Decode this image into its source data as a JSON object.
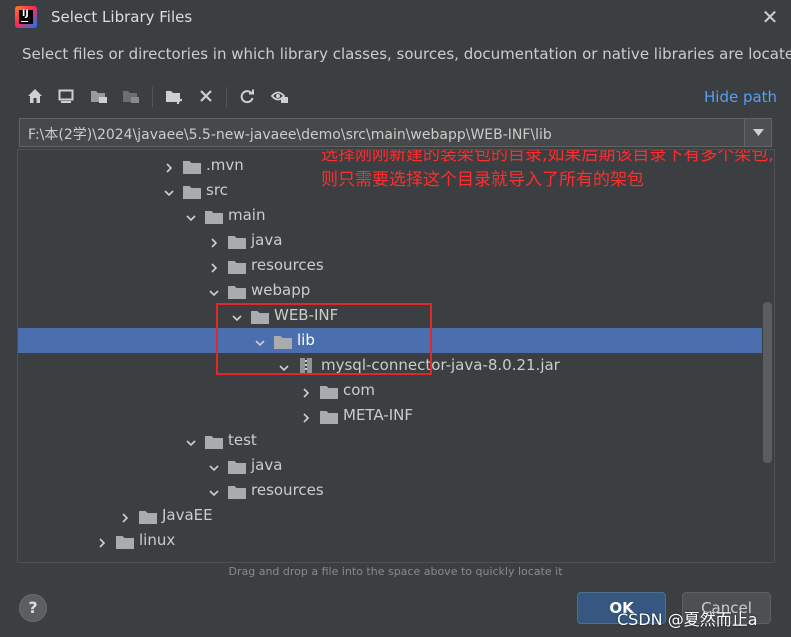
{
  "window": {
    "title": "Select Library Files",
    "close_glyph": "✕",
    "app_logo_text": "IJ",
    "description": "Select files or directories in which library classes, sources, documentation or native libraries are located"
  },
  "toolbar": {
    "buttons": [
      "home-icon",
      "desktop-icon",
      "project-folder-icon",
      "module-folder-icon",
      "new-folder-icon",
      "delete-icon",
      "refresh-icon",
      "show-hidden-icon"
    ],
    "hide_path_label": "Hide path"
  },
  "path": {
    "value": "F:\\本(2学)\\2024\\javaee\\5.5-new-javaee\\demo\\src\\main\\webapp\\WEB-INF\\lib"
  },
  "tree": {
    "rows": [
      {
        "label": ".mvn",
        "expanded": false,
        "type": "folder"
      },
      {
        "label": "src",
        "expanded": true,
        "type": "folder"
      },
      {
        "label": "main",
        "expanded": true,
        "type": "folder"
      },
      {
        "label": "java",
        "expanded": false,
        "type": "folder"
      },
      {
        "label": "resources",
        "expanded": false,
        "type": "folder"
      },
      {
        "label": "webapp",
        "expanded": true,
        "type": "folder"
      },
      {
        "label": "WEB-INF",
        "expanded": true,
        "type": "folder"
      },
      {
        "label": "lib",
        "expanded": true,
        "type": "folder",
        "selected": true
      },
      {
        "label": "mysql-connector-java-8.0.21.jar",
        "expanded": true,
        "type": "jar"
      },
      {
        "label": "com",
        "expanded": false,
        "type": "folder"
      },
      {
        "label": "META-INF",
        "expanded": false,
        "type": "folder"
      },
      {
        "label": "test",
        "expanded": true,
        "type": "folder"
      },
      {
        "label": "java",
        "expanded": true,
        "type": "folder"
      },
      {
        "label": "resources",
        "expanded": true,
        "type": "folder"
      },
      {
        "label": "JavaEE",
        "expanded": false,
        "type": "folder"
      },
      {
        "label": "linux",
        "expanded": false,
        "type": "folder"
      }
    ]
  },
  "annotation": {
    "text": "选择刚刚新建的装架包的目录,如果后期该目录下有多个架包,则只需要选择这个目录就导入了所有的架包",
    "color": "#ff2d2d"
  },
  "footer": {
    "drag_hint": "Drag and drop a file into the space above to quickly locate it",
    "help_label": "?",
    "ok_label": "OK",
    "cancel_label": "Cancel",
    "watermark": "CSDN @夏然而止a"
  },
  "colors": {
    "background": "#3c3f41",
    "selection": "#4b6eaf",
    "link": "#589df6",
    "ok_button": "#365880"
  }
}
